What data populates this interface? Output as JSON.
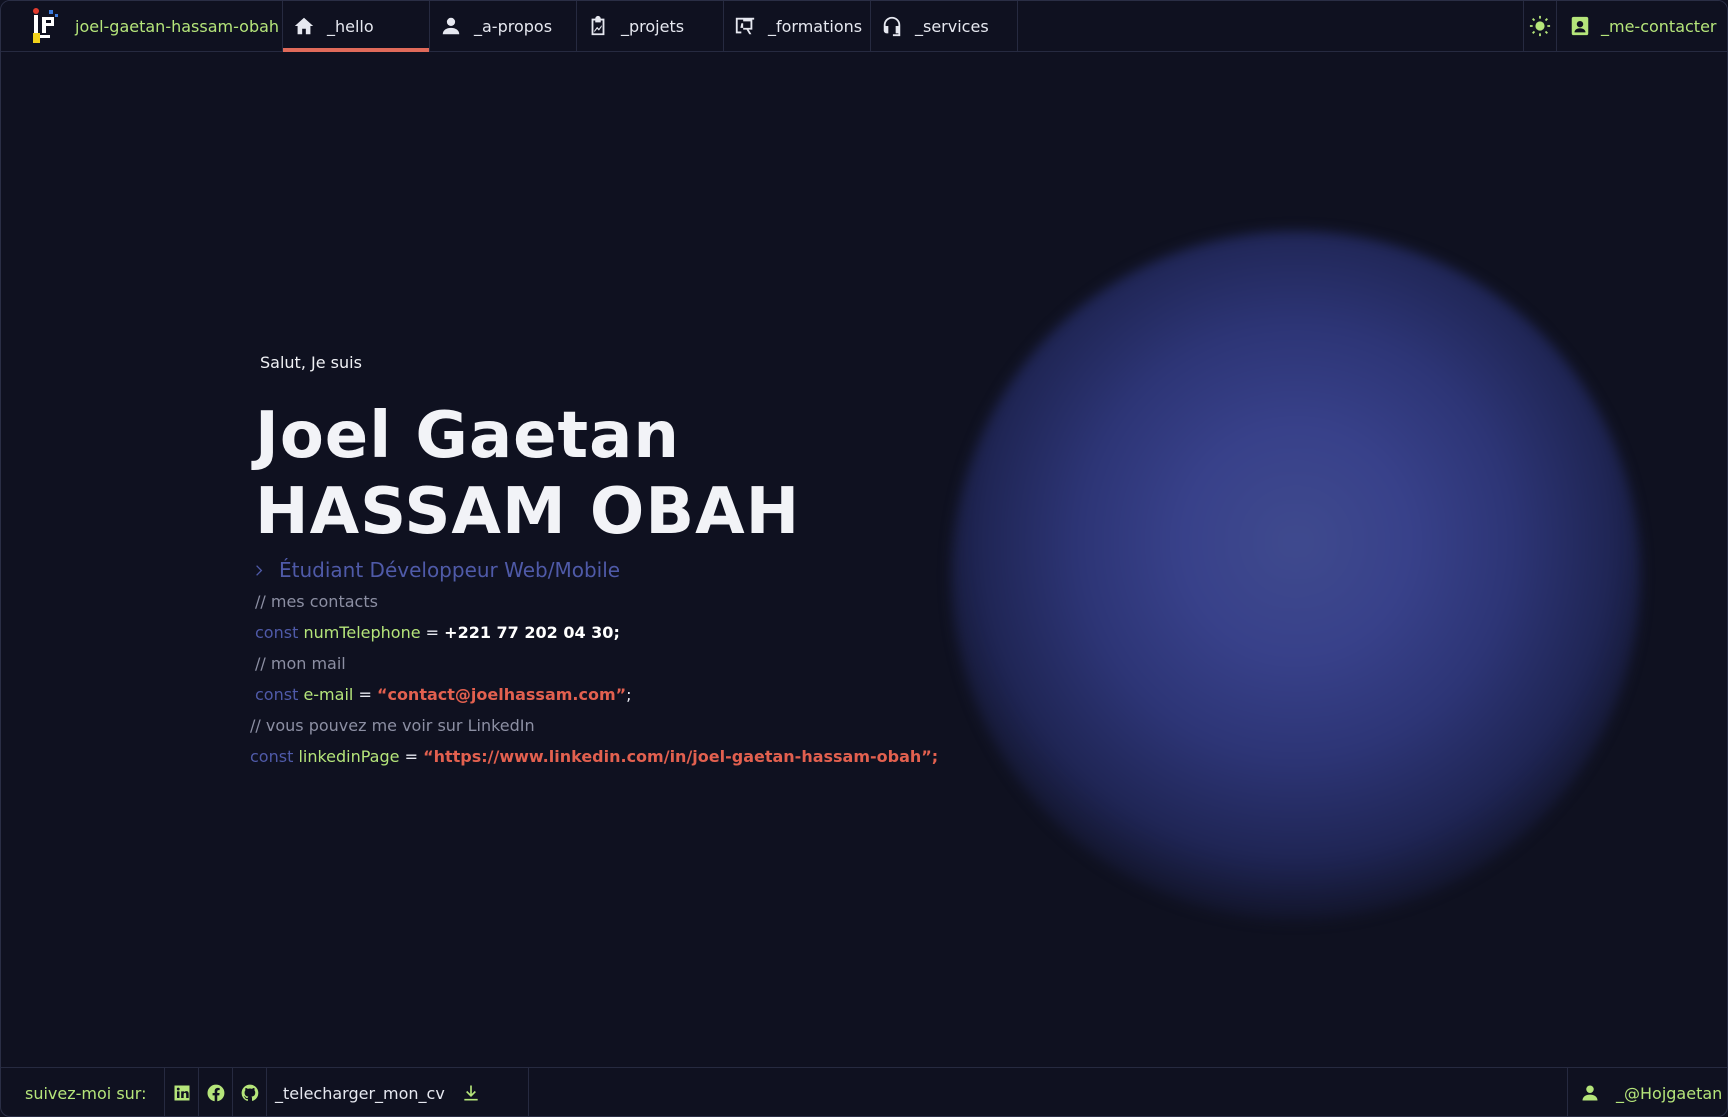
{
  "brand": {
    "name": "joel-gaetan-hassam-obah"
  },
  "nav": {
    "items": [
      {
        "label": "_hello",
        "icon": "home-icon",
        "active": true
      },
      {
        "label": "_a-propos",
        "icon": "person-icon",
        "active": false
      },
      {
        "label": "_projets",
        "icon": "chart-clipboard-icon",
        "active": false
      },
      {
        "label": "_formations",
        "icon": "teaching-board-icon",
        "active": false
      },
      {
        "label": "_services",
        "icon": "headset-icon",
        "active": false
      }
    ],
    "theme_icon": "sun-icon",
    "contact_label": "_me-contacter"
  },
  "hero": {
    "greeting": "Salut, Je suis",
    "name_first": "Joel Gaetan",
    "name_last": "HASSAM OBAH",
    "role": "Étudiant Développeur Web/Mobile",
    "code": {
      "c1": "// mes contacts",
      "kw": "const",
      "v1": "numTelephone",
      "eq": "=",
      "phone": "+221 77 202 04 30;",
      "c2": "// mon mail",
      "v2": "e-mail",
      "email": "“contact@joelhassam.com”",
      "semi": ";",
      "c3": "// vous pouvez me voir sur LinkedIn",
      "v3": "linkedinPage",
      "linkedin": "“https://www.linkedin.com/in/joel-gaetan-hassam-obah”;"
    }
  },
  "footer": {
    "follow_label": "suivez-moi sur:",
    "cv_label": "_telecharger_mon_cv",
    "handle": "_@Hojgaetan"
  },
  "colors": {
    "background": "#0f1120",
    "accent_green": "#b5e57a",
    "accent_red": "#e06a5a",
    "keyword_blue": "#4f5aa8"
  }
}
